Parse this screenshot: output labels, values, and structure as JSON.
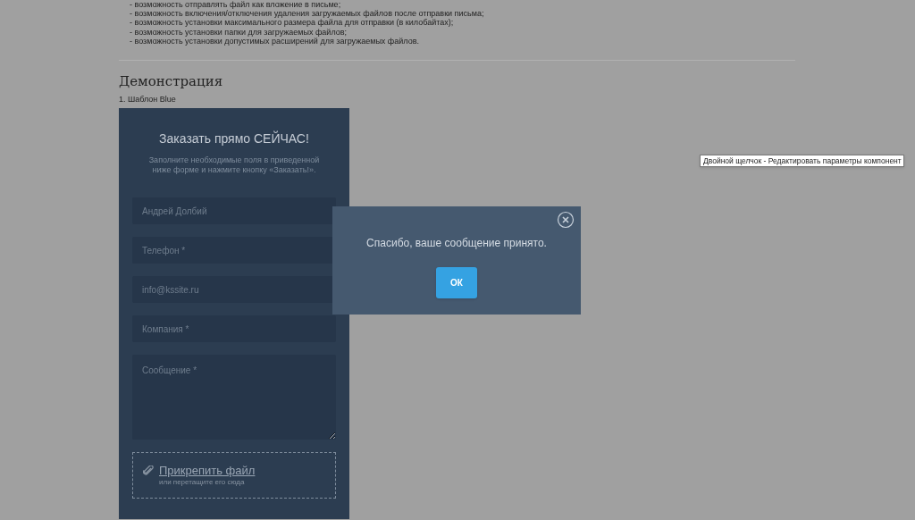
{
  "features": [
    "- возможность отправлять файл как вложение в письме;",
    "- возможность включения/отключения удаления загружаемых файлов после отправки письма;",
    "- возможность установки максимального размера файла для отправки (в килобайтах);",
    "- возможность установки папки для загружаемых файлов;",
    "- возможность установки допустимых расширений для загружаемых файлов."
  ],
  "section_title": "Демонстрация",
  "demo_label": "1. Шаблон Blue",
  "form": {
    "title": "Заказать прямо СЕЙЧАС!",
    "subtitle": "Заполните необходимые поля в приведенной ниже форме и нажмите кнопку «Заказать!».",
    "fields": [
      {
        "kind": "input",
        "placeholder": "Андрей Долбий"
      },
      {
        "kind": "input",
        "placeholder": "Телефон *"
      },
      {
        "kind": "input",
        "placeholder": "info@kssite.ru"
      },
      {
        "kind": "input",
        "placeholder": "Компания *"
      },
      {
        "kind": "textarea",
        "placeholder": "Сообщение *"
      }
    ],
    "attach": {
      "link": "Прикрепить файл",
      "hint": "или перетащите его сюда"
    }
  },
  "dialog": {
    "message": "Спасибо, ваше сообщение принято.",
    "button": "ОК"
  },
  "tooltip": "Двойной щелчок - Редактировать параметры компонент"
}
